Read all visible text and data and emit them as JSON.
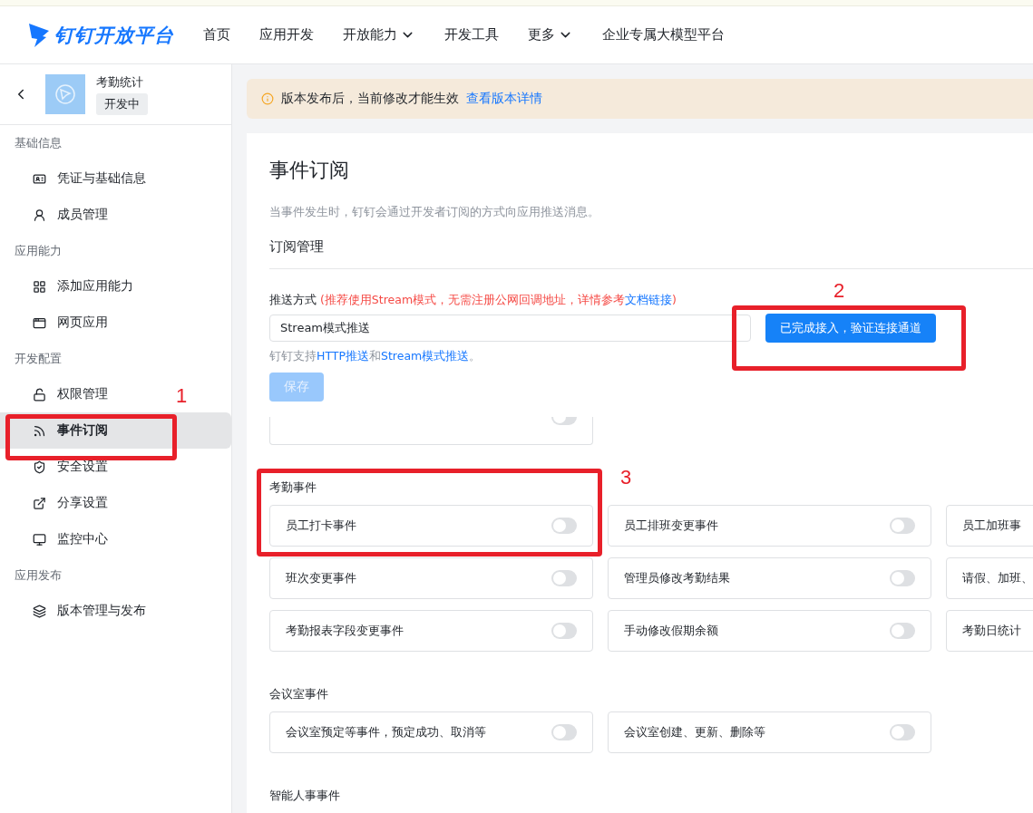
{
  "header": {
    "logo": "钉钉开放平台",
    "nav": [
      {
        "label": "首页",
        "dropdown": false
      },
      {
        "label": "应用开发",
        "dropdown": false
      },
      {
        "label": "开放能力",
        "dropdown": true
      },
      {
        "label": "开发工具",
        "dropdown": false
      },
      {
        "label": "更多",
        "dropdown": true
      },
      {
        "label": "企业专属大模型平台",
        "dropdown": false
      }
    ]
  },
  "app": {
    "name": "考勤统计",
    "status": "开发中"
  },
  "sidebar": [
    {
      "group": "基础信息",
      "items": [
        {
          "label": "凭证与基础信息",
          "selected": false
        },
        {
          "label": "成员管理",
          "selected": false
        }
      ]
    },
    {
      "group": "应用能力",
      "items": [
        {
          "label": "添加应用能力",
          "selected": false
        },
        {
          "label": "网页应用",
          "selected": false
        }
      ]
    },
    {
      "group": "开发配置",
      "items": [
        {
          "label": "权限管理",
          "selected": false
        },
        {
          "label": "事件订阅",
          "selected": true
        },
        {
          "label": "安全设置",
          "selected": false
        },
        {
          "label": "分享设置",
          "selected": false
        },
        {
          "label": "监控中心",
          "selected": false
        }
      ]
    },
    {
      "group": "应用发布",
      "items": [
        {
          "label": "版本管理与发布",
          "selected": false
        }
      ]
    }
  ],
  "notice": {
    "text": "版本发布后，当前修改才能生效",
    "link": "查看版本详情"
  },
  "page": {
    "title": "事件订阅",
    "description": "当事件发生时，钉钉会通过开发者订阅的方式向应用推送消息。",
    "section": "订阅管理"
  },
  "push": {
    "label": "推送方式",
    "hint": "(推荐使用Stream模式，无需注册公网回调地址，详情参考",
    "hint_link": "文档链接",
    "hint_end": ")",
    "value": "Stream模式推送",
    "verify_button": "已完成接入，验证连接通道",
    "support_prefix": "钉钉支持",
    "support_link_1": "HTTP推送",
    "support_mid": "和",
    "support_link_2": "Stream模式推送",
    "support_end": "。",
    "save_button": "保存",
    "save_disabled": true
  },
  "partial_card": {
    "on": false
  },
  "event_groups": [
    {
      "title": "考勤事件",
      "events": [
        {
          "label": "员工打卡事件",
          "on": false
        },
        {
          "label": "员工排班变更事件",
          "on": false
        },
        {
          "label": "员工加班事"
        },
        {
          "label": "班次变更事件",
          "on": false
        },
        {
          "label": "管理员修改考勤结果",
          "on": false
        },
        {
          "label": "请假、加班、"
        },
        {
          "label": "考勤报表字段变更事件",
          "on": false
        },
        {
          "label": "手动修改假期余额",
          "on": false
        },
        {
          "label": "考勤日统计"
        }
      ]
    },
    {
      "title": "会议室事件",
      "events": [
        {
          "label": "会议室预定等事件，预定成功、取消等",
          "on": false
        },
        {
          "label": "会议室创建、更新、删除等",
          "on": false
        }
      ]
    },
    {
      "title": "智能人事事件"
    }
  ],
  "annotations": [
    {
      "number": "1"
    },
    {
      "number": "2"
    },
    {
      "number": "3"
    }
  ]
}
